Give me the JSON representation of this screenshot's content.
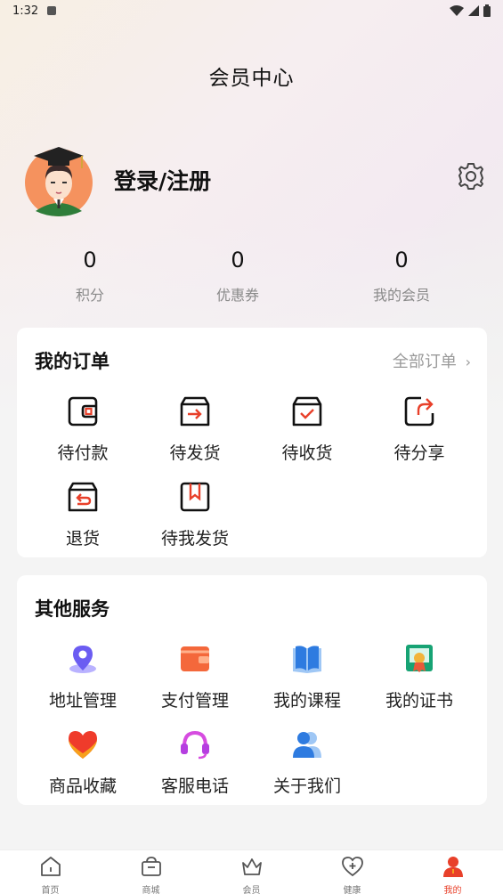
{
  "status_bar": {
    "time": "1:32"
  },
  "header": {
    "title": "会员中心"
  },
  "profile": {
    "login_label": "登录/注册"
  },
  "stats": [
    {
      "value": "0",
      "label": "积分"
    },
    {
      "value": "0",
      "label": "优惠券"
    },
    {
      "value": "0",
      "label": "我的会员"
    }
  ],
  "orders": {
    "title": "我的订单",
    "all_label": "全部订单",
    "items": [
      {
        "label": "待付款",
        "icon": "wallet-icon"
      },
      {
        "label": "待发货",
        "icon": "box-send-icon"
      },
      {
        "label": "待收货",
        "icon": "box-check-icon"
      },
      {
        "label": "待分享",
        "icon": "share-icon"
      },
      {
        "label": "退货",
        "icon": "return-icon"
      },
      {
        "label": "待我发货",
        "icon": "package-icon"
      }
    ]
  },
  "services": {
    "title": "其他服务",
    "items": [
      {
        "label": "地址管理",
        "icon": "location-icon"
      },
      {
        "label": "支付管理",
        "icon": "payment-wallet-icon"
      },
      {
        "label": "我的课程",
        "icon": "book-icon"
      },
      {
        "label": "我的证书",
        "icon": "certificate-icon"
      },
      {
        "label": "商品收藏",
        "icon": "heart-icon"
      },
      {
        "label": "客服电话",
        "icon": "headset-icon"
      },
      {
        "label": "关于我们",
        "icon": "people-icon"
      }
    ]
  },
  "tabbar": {
    "active_color": "#e8402a",
    "items": [
      {
        "label": "首页",
        "icon": "home-icon"
      },
      {
        "label": "商城",
        "icon": "shop-icon"
      },
      {
        "label": "会员",
        "icon": "crown-icon"
      },
      {
        "label": "健康",
        "icon": "health-icon"
      },
      {
        "label": "我的",
        "icon": "user-icon"
      }
    ]
  }
}
